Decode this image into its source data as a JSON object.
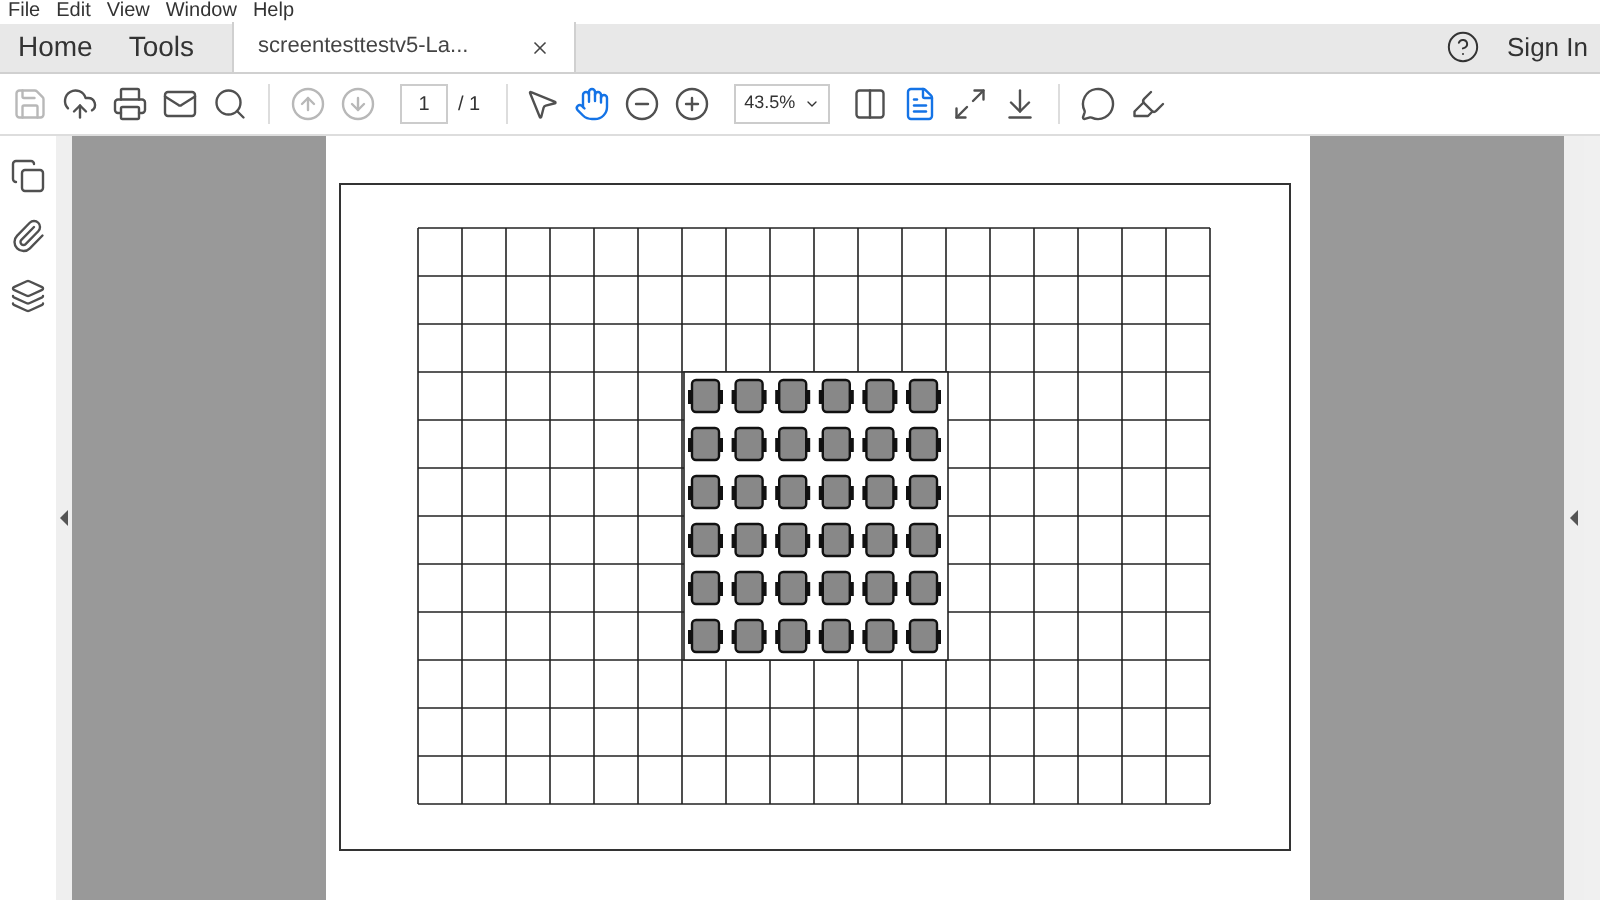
{
  "menu_bar": [
    "File",
    "Edit",
    "View",
    "Window",
    "Help"
  ],
  "tabs": [
    {
      "label": "Home",
      "selected": false
    },
    {
      "label": "Tools",
      "selected": false
    },
    {
      "label": "screentesttestv5-La...",
      "selected": true
    }
  ],
  "sign_in": "Sign In",
  "toolbar": {
    "save": {
      "disabled": true
    },
    "prev_page": {
      "disabled": true
    },
    "next_page": {
      "disabled": true
    },
    "page_number": "1",
    "page_total": "/ 1",
    "select_tool": {
      "selected": false
    },
    "hand_tool": {
      "selected": true
    },
    "zoom": "43.5%"
  }
}
